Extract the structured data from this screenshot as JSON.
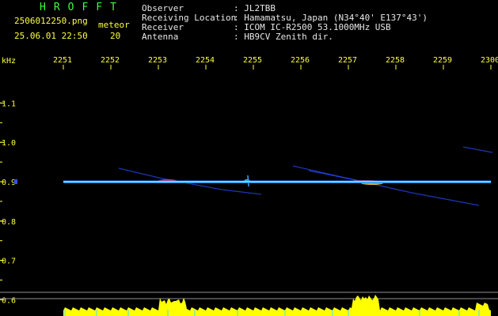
{
  "header": {
    "app_title": "HROFFT",
    "filename": "2506012250.png",
    "datetime": "25.06.01 22:50",
    "mode_label": "meteor",
    "meteor_count": "20",
    "info": [
      {
        "label": "Observer",
        "value": ": JL2TBB"
      },
      {
        "label": "Receiving Location",
        "value": ": Hamamatsu, Japan (N34°40' E137°43')"
      },
      {
        "label": "Receiver",
        "value": ": ICOM IC-R2500 53.1000MHz USB"
      },
      {
        "label": "Antenna",
        "value": ": HB9CV Zenith dir."
      }
    ]
  },
  "chart_data": {
    "type": "heatmap",
    "y_unit": "kHz",
    "x_ticks": [
      "2251",
      "2252",
      "2253",
      "2254",
      "2255",
      "2256",
      "2257",
      "2258",
      "2259",
      "2300"
    ],
    "y_ticks": [
      "1.1",
      "1.0",
      "0.9",
      "0.8",
      "0.7",
      "0.6"
    ],
    "ylim": [
      0.58,
      1.17
    ],
    "carrier_khz": 0.9,
    "colors": {
      "background": "#000000",
      "axis_text": "#ffff3c",
      "header_text": "#3cff3c",
      "carrier": "#3cffe0",
      "level_bars": "#ffff00"
    }
  }
}
